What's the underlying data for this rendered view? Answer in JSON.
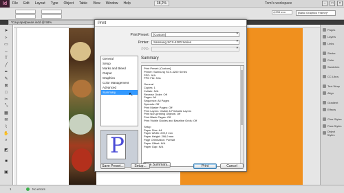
{
  "menubar": {
    "logo": "Id",
    "items": [
      "File",
      "Edit",
      "Layout",
      "Type",
      "Object",
      "Table",
      "View",
      "Window",
      "Help"
    ],
    "zoom": "38,2%",
    "workspace": "Tomi's workspace"
  },
  "controlbar": {
    "width_value": "4,233 mm",
    "style_dropdown": "[Basic Graphics Frame]+"
  },
  "document_tab": "*Сацхарифаная.indd @ 58%",
  "statusbar": {
    "page": "1",
    "status_text": "No errors"
  },
  "panels": [
    "Pages",
    "Layers",
    "Links",
    "Stroke",
    "Color",
    "Swatches",
    "CC Libra.",
    "Text Wrap",
    "Align",
    "Gradient",
    "Effects",
    "Char Styles",
    "Para Styles",
    "Object Styles"
  ],
  "dialog": {
    "title": "Print",
    "print_preset_label": "Print Preset:",
    "print_preset_value": "[Custom]",
    "printer_label": "Printer:",
    "printer_value": "Samsung SCX-4200 Series",
    "ppd_label": "PPD:",
    "ppd_value": "",
    "categories": [
      "General",
      "Setup",
      "Marks and Bleed",
      "Output",
      "Graphics",
      "Color Management",
      "Advanced",
      "Summary"
    ],
    "selected_category": "Summary",
    "preview_letter": "P",
    "summary_heading": "Summary",
    "summary_lines": [
      "Print Preset: [Custom]",
      "Printer: Samsung SCX-4200 Series",
      "PPD: N/A",
      "PPD File: N/A",
      "",
      "General",
      "Copies: 1",
      "Collate: N/A",
      "Reverse Order: Off",
      "Pages: All",
      "Sequence: All Pages",
      "Spreads: Off",
      "Print Master Pages: Off",
      "Print Layers: Visible & Printable Layers",
      "Print Non-printing Objects: Off",
      "Print Blank Pages: Off",
      "Print Visible Guides and Baseline Grids: Off",
      "",
      "Setup",
      "Paper Size: A4",
      "Paper Width: 209,9 mm",
      "Paper Height: 296,9 mm",
      "Page Orientation: Portrait",
      "Paper Offset: N/A",
      "Paper Gap: N/A"
    ],
    "buttons": {
      "save_preset": "Save Preset...",
      "setup": "Setup...",
      "save_summary": "Save Summary...",
      "print": "Print",
      "cancel": "Cancel"
    }
  }
}
